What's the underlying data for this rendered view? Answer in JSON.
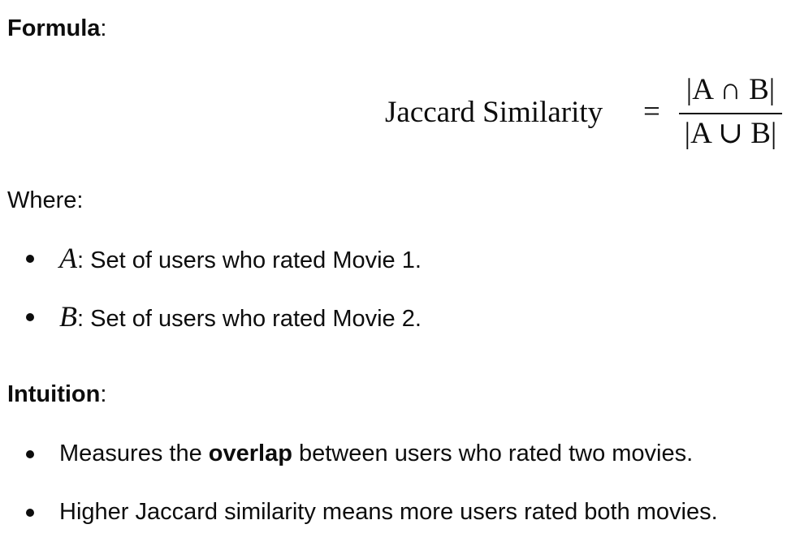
{
  "sections": {
    "formula_heading": "Formula",
    "heading_colon": ":",
    "where_label": "Where:",
    "intuition_heading": "Intuition"
  },
  "formula": {
    "lhs": "Jaccard Similarity",
    "equals": "=",
    "numerator": "|A ∩ B|",
    "denominator": "|A ∪ B|"
  },
  "where_items": [
    {
      "symbol": "A",
      "text": ": Set of users who rated Movie 1."
    },
    {
      "symbol": "B",
      "text": ": Set of users who rated Movie 2."
    }
  ],
  "intuition_items": [
    {
      "before": "Measures the ",
      "bold": "overlap",
      "after": " between users who rated two movies."
    },
    {
      "text": "Higher Jaccard similarity means more users rated both movies."
    }
  ]
}
